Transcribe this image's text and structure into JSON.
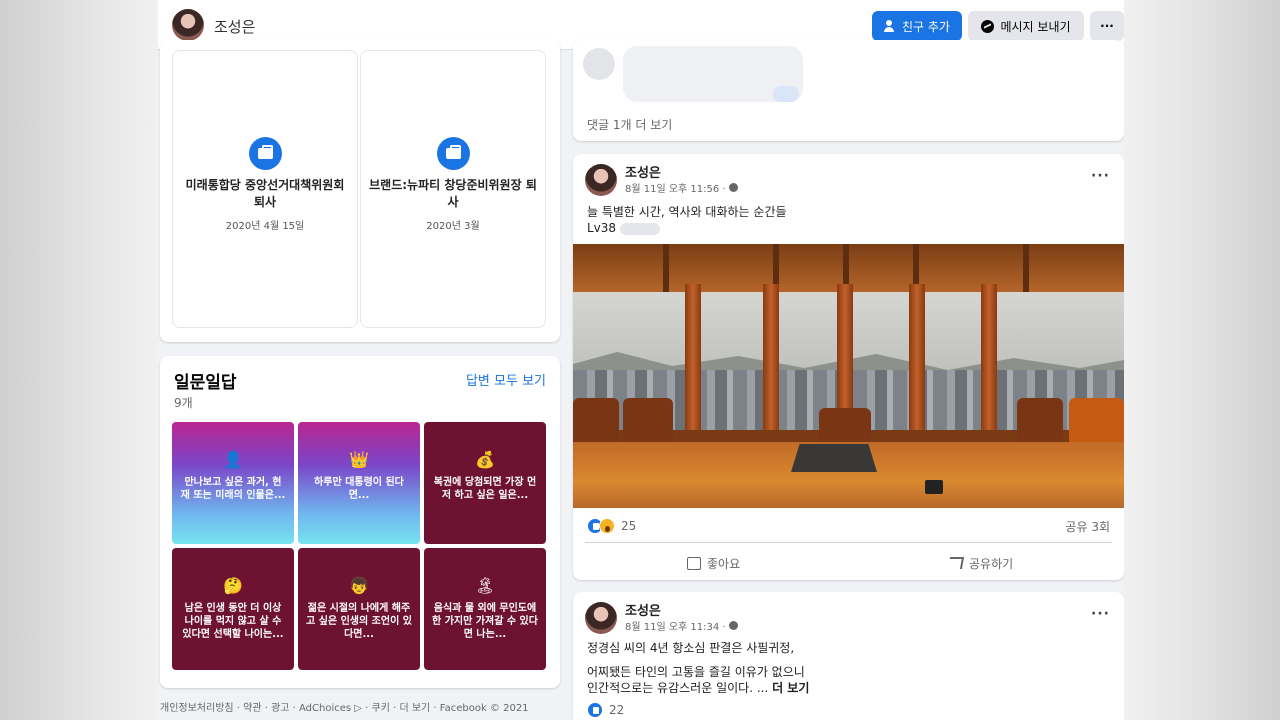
{
  "profile": {
    "name": "조성은",
    "add_friend_label": "친구 추가",
    "message_label": "메시지 보내기",
    "more_label": "···"
  },
  "work": [
    {
      "title": "미래통합당 중앙선거대책위원회 퇴사",
      "date": "2020년 4월 15일"
    },
    {
      "title": "브랜드:뉴파티 창당준비위원장 퇴사",
      "date": "2020년 3월"
    }
  ],
  "qa": {
    "title": "일문일답",
    "count": "9개",
    "see_all": "답변 모두 보기",
    "tiles": [
      {
        "emoji": "👤",
        "text": "만나보고 싶은 과거, 현재 또는 미래의 인물은...",
        "style": "gradient"
      },
      {
        "emoji": "👑",
        "text": "하루만 대통령이 된다면...",
        "style": "gradient"
      },
      {
        "emoji": "💰",
        "text": "복권에 당첨되면 가장 먼저 하고 싶은 일은...",
        "style": "maroon"
      },
      {
        "emoji": "🤔",
        "text": "남은 인생 동안 더 이상 나이를 먹지 않고 살 수 있다면 선택할 나이는...",
        "style": "maroon"
      },
      {
        "emoji": "👦",
        "text": "젊은 시절의 나에게 해주고 싶은 인생의 조언이 있다면...",
        "style": "maroon"
      },
      {
        "emoji": "🏝",
        "text": "음식과 물 외에 무인도에 한 가지만 가져갈 수 있다면 나는...",
        "style": "maroon"
      }
    ]
  },
  "footer": "개인정보처리방침 · 약관 · 광고 · AdChoices ▷ · 쿠키 · 더 보기 · Facebook © 2021",
  "comments": {
    "more": "댓글 1개 더 보기"
  },
  "posts": [
    {
      "author": "조성은",
      "time": "8월 11일 오후 11:56 ·",
      "line1": "늘 특별한 시간, 역사와 대화하는 순간들",
      "line2": "Lv38",
      "reaction_count": "25",
      "shares": "공유 3회",
      "like_label": "좋아요",
      "share_label": "공유하기"
    },
    {
      "author": "조성은",
      "time": "8월 11일 오후 11:34 ·",
      "line1": "정경심 씨의 4년 항소심 판결은 사필귀정,",
      "line2": "어찌됐든 타인의 고통을 즐길 이유가 없으니",
      "line3": "인간적으로는 유감스러운 일이다. ...",
      "see_more": "더 보기",
      "reaction_count": "22"
    }
  ],
  "colors": {
    "accent": "#1b74e4",
    "tile_maroon": "#6e1232"
  }
}
